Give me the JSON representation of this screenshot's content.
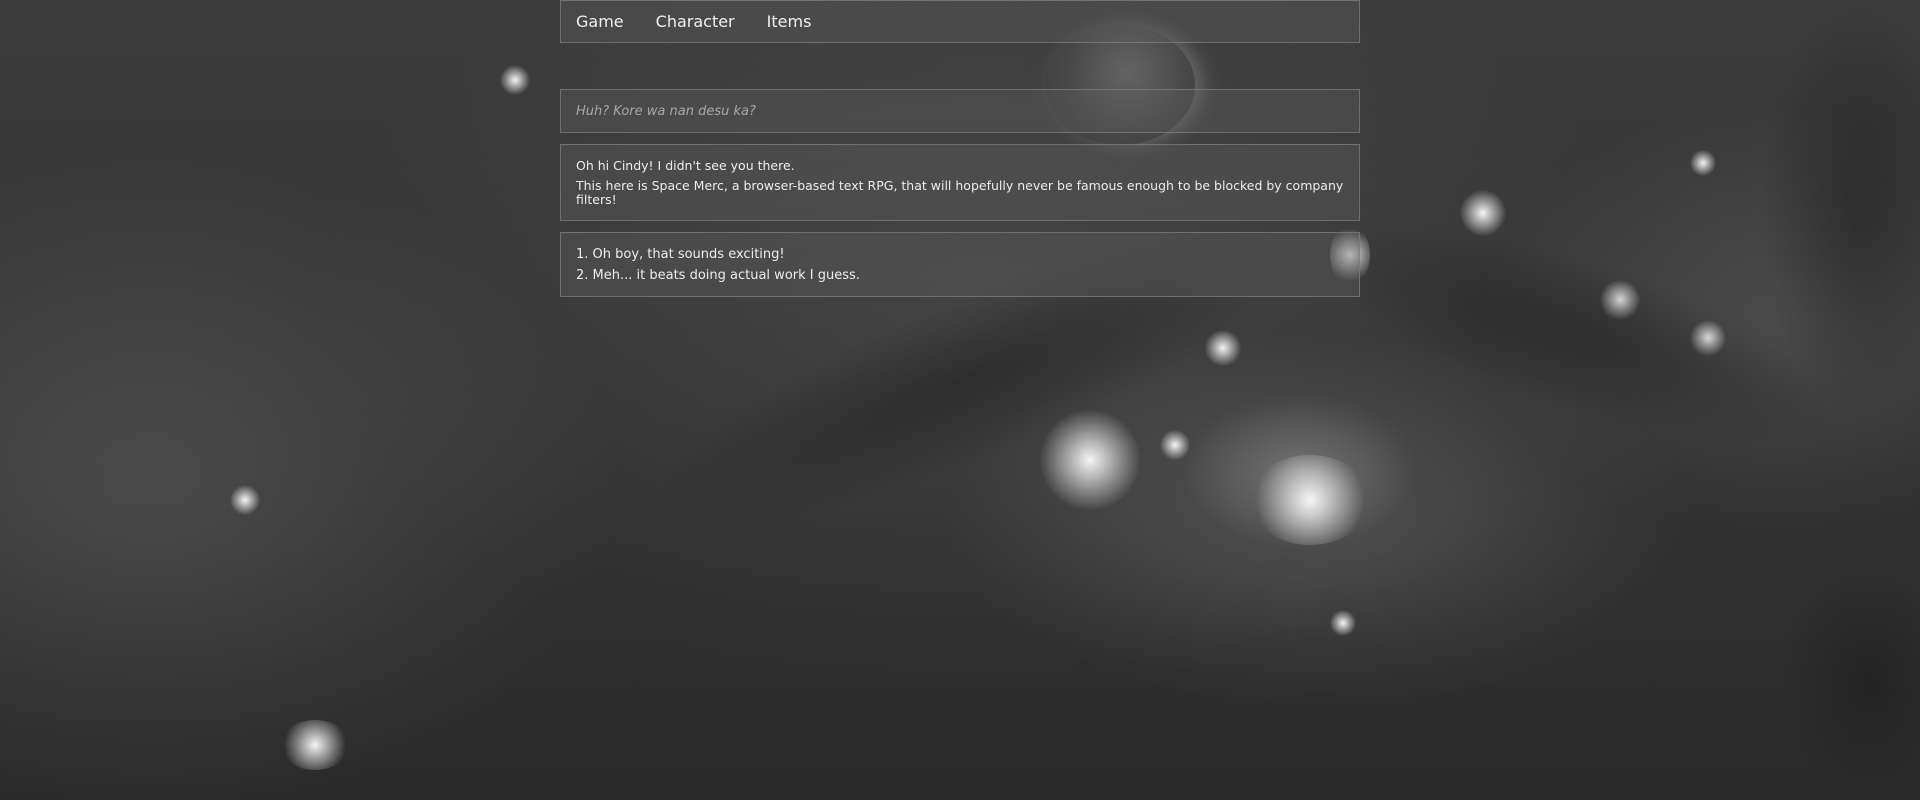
{
  "nav": {
    "items": [
      {
        "label": "Game"
      },
      {
        "label": "Character"
      },
      {
        "label": "Items"
      }
    ]
  },
  "story": {
    "narration": "Huh? Kore wa nan desu ka?",
    "dialog": [
      "Oh hi Cindy! I didn't see you there.",
      "This here is Space Merc, a browser-based text RPG, that will hopefully never be famous enough to be blocked by company filters!"
    ],
    "choices": [
      "1. Oh boy, that sounds exciting!",
      "2. Meh... it beats doing actual work I guess."
    ]
  }
}
